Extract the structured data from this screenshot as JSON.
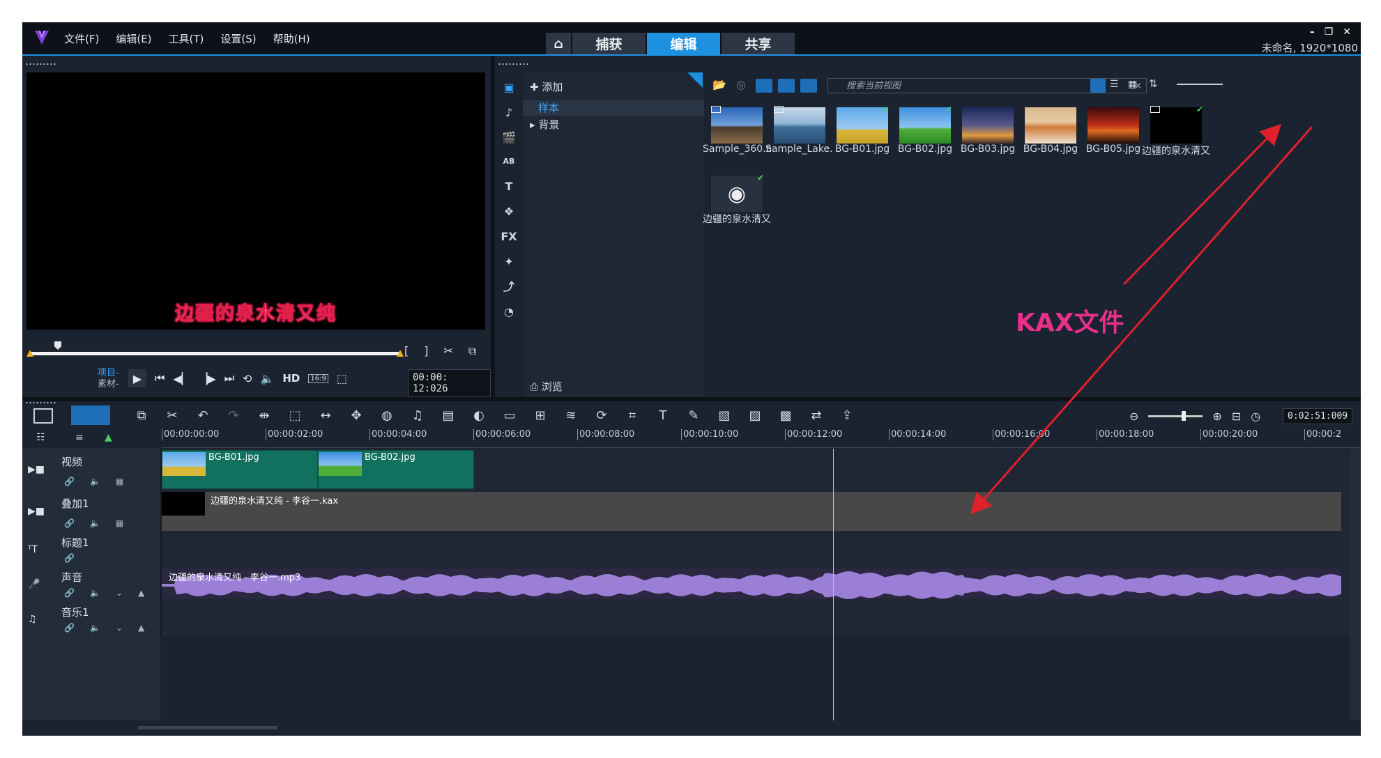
{
  "menu": {
    "file": "文件(F)",
    "edit": "编辑(E)",
    "tools": "工具(T)",
    "settings": "设置(S)",
    "help": "帮助(H)"
  },
  "mode_tabs": {
    "capture": "捕获",
    "edit": "编辑",
    "share": "共享"
  },
  "project_info": "未命名, 1920*1080",
  "player": {
    "subtitle": "边疆的泉水清又纯",
    "mode_project": "项目-",
    "mode_clip": "素材-",
    "hd": "HD",
    "aspect": "16:9",
    "timecode": "00:00: 12:026"
  },
  "library": {
    "add_label": "添加",
    "tree": {
      "sample": "样本",
      "background": "背景"
    },
    "browse_label": "浏览",
    "search_placeholder": "搜索当前视图",
    "fx_label": "FX",
    "items": [
      {
        "caption": "Sample_360.m...",
        "checked": false
      },
      {
        "caption": "Sample_Lake...",
        "checked": false
      },
      {
        "caption": "BG-B01.jpg",
        "checked": true
      },
      {
        "caption": "BG-B02.jpg",
        "checked": true
      },
      {
        "caption": "BG-B03.jpg",
        "checked": false
      },
      {
        "caption": "BG-B04.jpg",
        "checked": false
      },
      {
        "caption": "BG-B05.jpg",
        "checked": false
      },
      {
        "caption": "边疆的泉水清又...",
        "checked": true
      },
      {
        "caption": "边疆的泉水清又...",
        "checked": true
      }
    ]
  },
  "annotation": "KAX文件",
  "timeline": {
    "duration": "0:02:51:009",
    "ruler": [
      "00:00:00:00",
      "00:00:02:00",
      "00:00:04:00",
      "00:00:06:00",
      "00:00:08:00",
      "00:00:10:00",
      "00:00:12:00",
      "00:00:14:00",
      "00:00:16:00",
      "00:00:18:00",
      "00:00:20:00",
      "00:00:2"
    ],
    "tracks": {
      "video": "视频",
      "overlay": "叠加1",
      "title": "标题1",
      "voice": "声音",
      "music": "音乐1"
    },
    "clips": {
      "video1": "BG-B01.jpg",
      "video2": "BG-B02.jpg",
      "overlay": "边疆的泉水清又纯 - 李谷一.kax",
      "voice": "边疆的泉水清又纯 - 李谷一.mp3"
    }
  },
  "colors": {
    "accent": "#1e90e0",
    "annotation": "#e8308a",
    "clip_video": "#11705e",
    "waveform": "#9b7fd6"
  }
}
